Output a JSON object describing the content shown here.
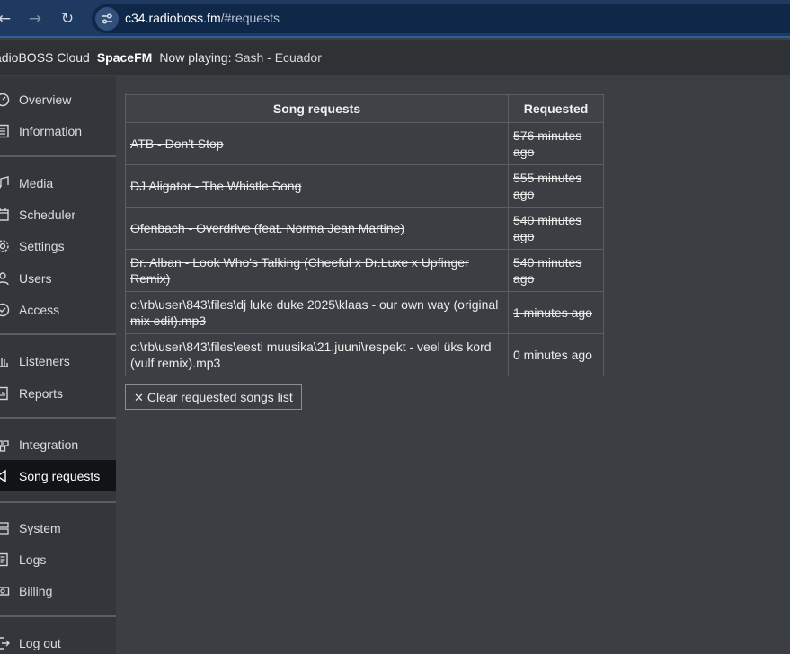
{
  "browser": {
    "url_host": "c34.radioboss.fm",
    "url_path": "/#requests"
  },
  "header": {
    "brand": "adioBOSS Cloud",
    "station": "SpaceFM",
    "now_playing_label": "Now playing:",
    "now_playing_value": "Sash - Ecuador"
  },
  "sidebar": {
    "items": [
      {
        "label": "Overview",
        "icon": "dashboard-icon"
      },
      {
        "label": "Information",
        "icon": "list-icon"
      },
      {
        "label": "Media",
        "icon": "music-note-icon"
      },
      {
        "label": "Scheduler",
        "icon": "calendar-icon"
      },
      {
        "label": "Settings",
        "icon": "gear-icon"
      },
      {
        "label": "Users",
        "icon": "user-icon"
      },
      {
        "label": "Access",
        "icon": "shield-check-icon"
      },
      {
        "label": "Listeners",
        "icon": "bar-chart-icon"
      },
      {
        "label": "Reports",
        "icon": "report-icon"
      },
      {
        "label": "Integration",
        "icon": "puzzle-icon"
      },
      {
        "label": "Song requests",
        "icon": "megaphone-icon"
      },
      {
        "label": "System",
        "icon": "server-icon"
      },
      {
        "label": "Logs",
        "icon": "log-icon"
      },
      {
        "label": "Billing",
        "icon": "money-icon"
      },
      {
        "label": "Log out",
        "icon": "logout-icon"
      }
    ],
    "active": "Song requests"
  },
  "requests": {
    "columns": [
      "Song requests",
      "Requested"
    ],
    "rows": [
      {
        "song": "ATB - Don't Stop",
        "time": "576 minutes ago",
        "struck": true
      },
      {
        "song": "DJ Aligator - The Whistle Song",
        "time": "555 minutes ago",
        "struck": true
      },
      {
        "song": "Ofenbach - Overdrive (feat. Norma Jean Martine)",
        "time": "540 minutes ago",
        "struck": true
      },
      {
        "song": "Dr. Alban - Look Who's Talking (Cheeful x Dr.Luxe x Upfinger Remix)",
        "time": "540 minutes ago",
        "struck": true
      },
      {
        "song": "c:\\rb\\user\\843\\files\\dj luke duke 2025\\klaas - our own way (original mix edit).mp3",
        "time": "1 minutes ago",
        "struck": true
      },
      {
        "song": "c:\\rb\\user\\843\\files\\eesti muusika\\21.juuni\\respekt - veel üks kord (vulf remix).mp3",
        "time": "0 minutes ago",
        "struck": false
      }
    ],
    "clear_button_label": "Clear requested songs list"
  }
}
